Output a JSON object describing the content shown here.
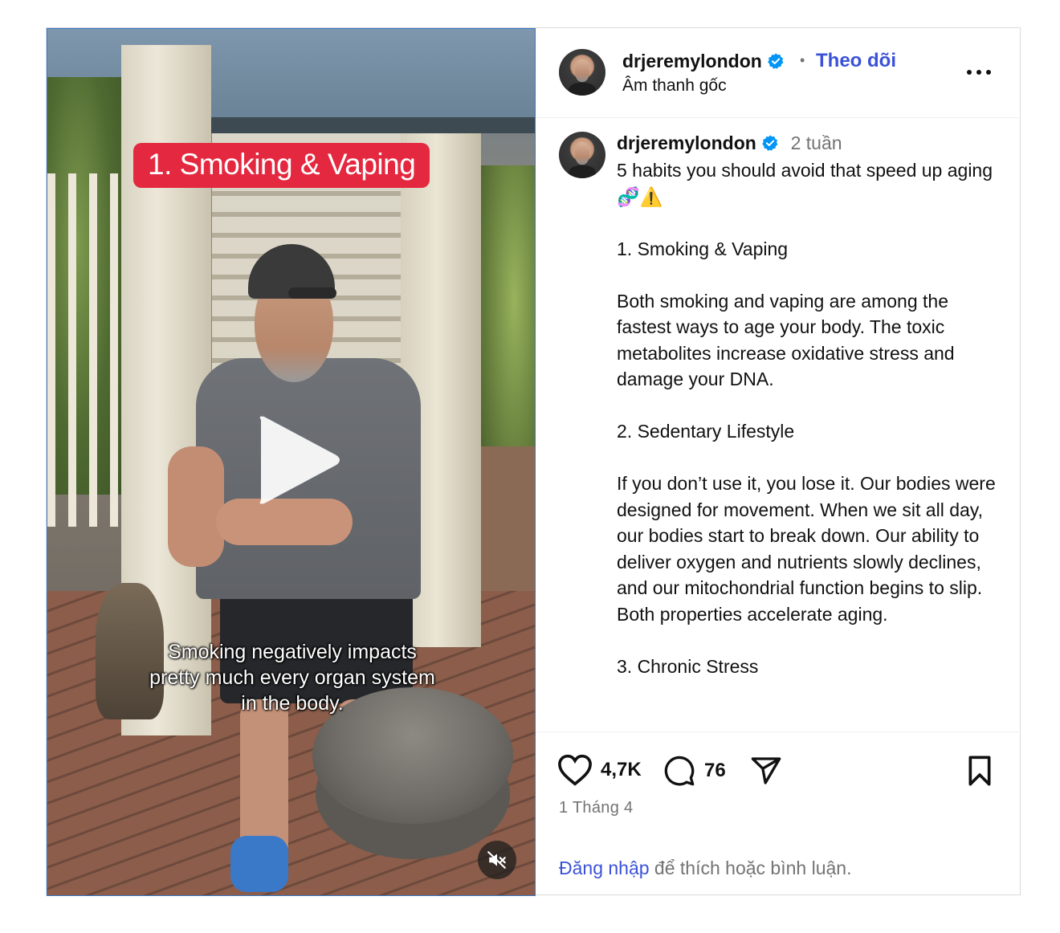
{
  "video": {
    "title_overlay": "1. Smoking & Vaping",
    "caption": "Smoking negatively impacts pretty much every organ system in the body.",
    "play_icon": "play-icon",
    "mute_icon": "speaker-muted-icon"
  },
  "header": {
    "username": "drjeremylondon",
    "verified_icon": "verified-badge-icon",
    "separator": "•",
    "follow_label": "Theo dõi",
    "audio_label": "Âm thanh gốc",
    "more_icon": "more-options-icon"
  },
  "caption_post": {
    "username": "drjeremylondon",
    "time_ago": "2 tuần",
    "text": "5 habits you should avoid that speed up aging 🧬⚠️\n\n1. Smoking & Vaping\n\nBoth smoking and vaping are among the fastest ways to age your body. The toxic metabolites increase oxidative stress and damage your DNA.\n\n2. Sedentary Lifestyle\n\nIf you don’t use it, you lose it. Our bodies were designed for movement. When we sit all day, our bodies start to break down. Our ability to deliver oxygen and nutrients slowly declines, and our mitochondrial function begins to slip. Both properties accelerate aging.\n\n3. Chronic Stress"
  },
  "actions": {
    "like_count": "4,7K",
    "comment_count": "76",
    "icons": [
      "heart-icon",
      "comment-icon",
      "share-icon",
      "bookmark-icon"
    ],
    "date": "1 Tháng 4",
    "login_link": "Đăng nhập",
    "login_rest": " để thích hoặc bình luận."
  },
  "colors": {
    "accent": "#3b52d6",
    "verified": "#0095f6",
    "badge_red": "#e4283f",
    "muted_text": "#737373"
  }
}
